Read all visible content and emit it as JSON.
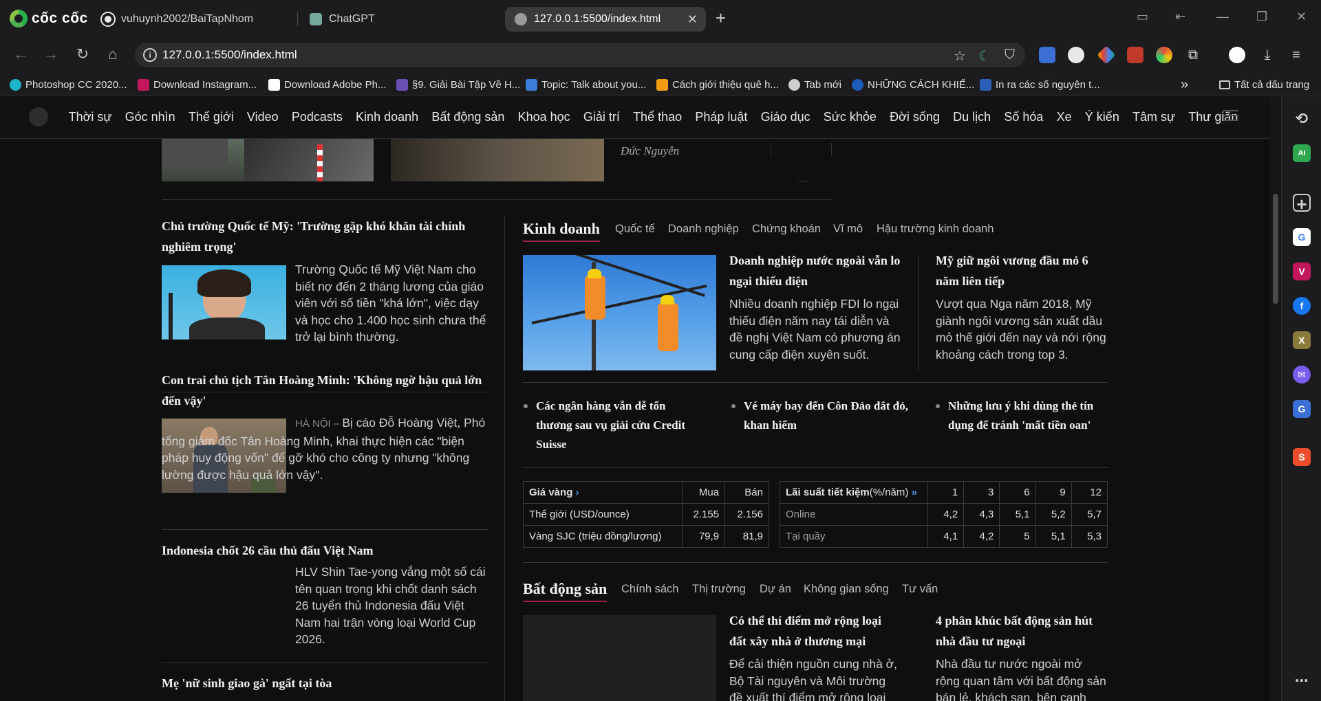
{
  "browser": {
    "brand": "cốc cốc",
    "tabs": [
      {
        "label": "vuhuynh2002/BaiTapNhom"
      },
      {
        "label": "ChatGPT"
      },
      {
        "label": "127.0.0.1:5500/index.html"
      }
    ],
    "url": "127.0.0.1:5500/index.html",
    "bookmarks": [
      "Photoshop CC 2020...",
      "Download Instagram...",
      "Download Adobe Ph...",
      "§9. Giải Bài Tập Về H...",
      "Topic: Talk about you...",
      "Cách giới thiệu quê h...",
      "Tab mới",
      "NHỮNG CÁCH KHIẾ...",
      "In ra các số nguyên t..."
    ],
    "all_bookmarks": "Tất cả dấu trang",
    "more_bookmarks": "»"
  },
  "site_nav": {
    "items": [
      "Thời sự",
      "Góc nhìn",
      "Thế giới",
      "Video",
      "Podcasts",
      "Kinh doanh",
      "Bất động sản",
      "Khoa học",
      "Giải trí",
      "Thể thao",
      "Pháp luật",
      "Giáo dục",
      "Sức khỏe",
      "Đời sống",
      "Du lịch",
      "Số hóa",
      "Xe",
      "Ý kiến",
      "Tâm sự",
      "Thư giãn"
    ]
  },
  "top_partial": {
    "author": "Đức Nguyễn"
  },
  "left_column": {
    "articles": [
      {
        "title": "Chủ trường Quốc tế Mỹ: 'Trường gặp khó khăn tài chính nghiêm trọng'",
        "location": "",
        "desc": "Trường Quốc tế Mỹ Việt Nam cho biết nợ đến 2 tháng lương của giáo viên với số tiền \"khá lớn\", việc dạy và học cho 1.400 học sinh chưa thể trở lại bình thường."
      },
      {
        "title": "Con trai chủ tịch Tân Hoàng Minh: 'Không ngờ hậu quả lớn đến vậy'",
        "location": "HÀ NỘI – ",
        "desc": "Bị cáo Đỗ Hoàng Việt, Phó tổng giám đốc Tân Hoàng Minh, khai thực hiện các \"biện pháp huy động vốn\" để gỡ khó cho công ty nhưng \"không lường được hậu quả lớn vậy\"."
      },
      {
        "title": "Indonesia chốt 26 cầu thủ đấu Việt Nam",
        "location": "",
        "desc": "HLV Shin Tae-yong vắng một số cái tên quan trọng khi chốt danh sách 26 tuyển thủ Indonesia đấu Việt Nam hai trận vòng loại World Cup 2026."
      },
      {
        "title": "Mẹ 'nữ sinh giao gà' ngất tại tòa",
        "location": "",
        "desc": ""
      }
    ]
  },
  "kinh_doanh": {
    "title": "Kinh doanh",
    "subs": [
      "Quốc tế",
      "Doanh nghiệp",
      "Chứng khoán",
      "Vĩ mô",
      "Hậu trường kinh doanh"
    ],
    "main": {
      "title": "Doanh nghiệp nước ngoài vẫn lo ngại thiếu điện",
      "desc": "Nhiều doanh nghiệp FDI lo ngại thiếu điện năm nay tái diễn và đề nghị Việt Nam có phương án cung cấp điện xuyên suốt."
    },
    "second": {
      "title": "Mỹ giữ ngôi vương đầu mỏ 6 năm liên tiếp",
      "desc": "Vượt qua Nga năm 2018, Mỹ giành ngôi vương sản xuất dầu mỏ thế giới đến nay và nới rộng khoảng cách trong top 3."
    },
    "bullets": [
      "Các ngân hàng vẫn dễ tổn thương sau vụ giải cứu Credit Suisse",
      "Vé máy bay đến Côn Đảo đắt đỏ, khan hiếm",
      "Những lưu ý khi dùng thẻ tín dụng để tránh 'mất tiền oan'"
    ],
    "gold": {
      "header": "Giá vàng",
      "arrow": "›",
      "cols": [
        "Mua",
        "Bán"
      ],
      "rows": [
        {
          "label": "Thế giới (USD/ounce)",
          "buy": "2.155",
          "sell": "2.156"
        },
        {
          "label": "Vàng SJC (triệu đồng/lượng)",
          "buy": "79,9",
          "sell": "81,9"
        }
      ]
    },
    "interest": {
      "header": "Lãi suất tiết kiệm",
      "unit": "(%/năm)",
      "arrow": "»",
      "cols": [
        "1",
        "3",
        "6",
        "9",
        "12"
      ],
      "rows": [
        {
          "label": "Online",
          "values": [
            "4,2",
            "4,3",
            "5,1",
            "5,2",
            "5,7"
          ]
        },
        {
          "label": "Tại quầy",
          "values": [
            "4,1",
            "4,2",
            "5",
            "5,1",
            "5,3"
          ]
        }
      ]
    }
  },
  "bat_dong_san": {
    "title": "Bất động sản",
    "subs": [
      "Chính sách",
      "Thị trường",
      "Dự án",
      "Không gian sống",
      "Tư vấn"
    ],
    "main": {
      "title": "Có thể thí điểm mở rộng loại đất xây nhà ở thương mại",
      "desc": "Để cải thiện nguồn cung nhà ở, Bộ Tài nguyên và Môi trường đề xuất thí điểm mở rộng loại"
    },
    "second": {
      "title": "4 phân khúc bất động sản hút nhà đầu tư ngoại",
      "desc": "Nhà đầu tư nước ngoài mở rộng quan tâm với bất động sản bán lẻ, khách sạn, bên cạnh"
    }
  }
}
